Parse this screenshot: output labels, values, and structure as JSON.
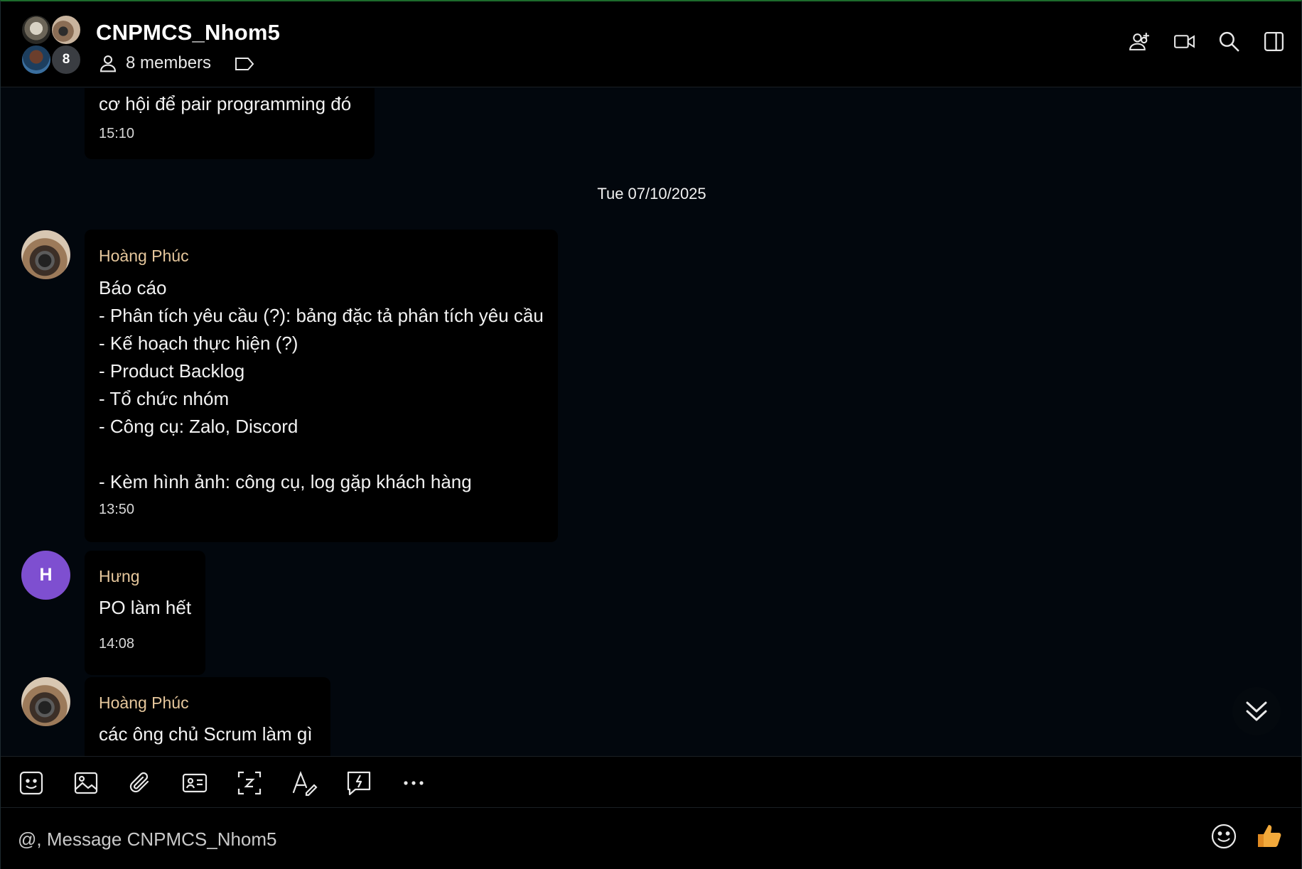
{
  "header": {
    "title": "CNPMCS_Nhom5",
    "members_label": "8 members",
    "avatar_overflow_count": "8",
    "icons": [
      "add-member-icon",
      "video-call-icon",
      "search-icon",
      "toggle-sidebar-icon"
    ]
  },
  "messages": [
    {
      "sender": "",
      "text": "cơ hội để pair programming đó",
      "time": "15:10"
    },
    {
      "sender": "Hoàng Phúc",
      "text": "Báo cáo\n- Phân tích yêu cầu (?): bảng đặc tả phân tích yêu cầu\n- Kế hoạch thực hiện (?)\n- Product Backlog\n- Tổ chức nhóm\n- Công cụ: Zalo, Discord\n\n- Kèm hình ảnh: công cụ, log gặp khách hàng",
      "time": "13:50"
    },
    {
      "sender": "Hưng",
      "avatar_initial": "H",
      "text": "PO làm hết",
      "time": "14:08"
    },
    {
      "sender": "Hoàng Phúc",
      "text": "các ông chủ Scrum làm gì",
      "time": ""
    }
  ],
  "date_separator": "Tue 07/10/2025",
  "toolbar": {
    "icons": [
      "sticker-icon",
      "image-icon",
      "attachment-icon",
      "contact-card-icon",
      "screenshot-icon",
      "text-format-icon",
      "quick-message-icon",
      "more-icon"
    ]
  },
  "composer": {
    "placeholder": "@, Message CNPMCS_Nhom5",
    "value": ""
  },
  "colors": {
    "sender_name": "#e6c79c",
    "avatar_h": "#7e4fd0",
    "like_icon": "#f2a93b"
  }
}
